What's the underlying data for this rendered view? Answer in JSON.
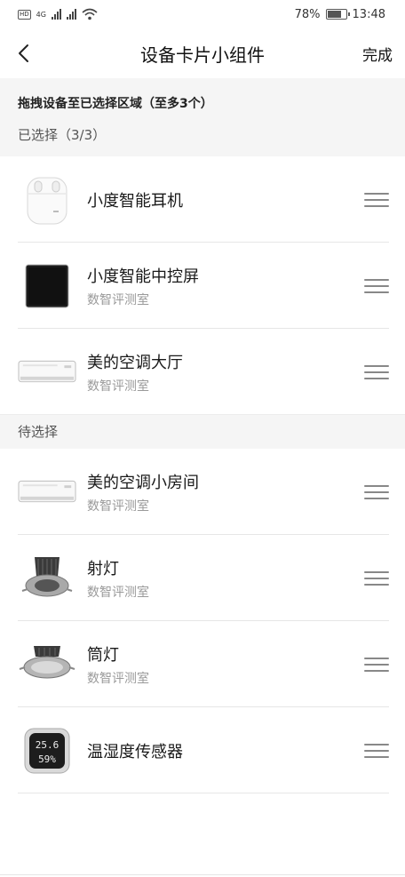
{
  "status": {
    "hd_label": "HD",
    "net_label": "4G",
    "battery": "78%",
    "time": "13:48"
  },
  "header": {
    "title": "设备卡片小组件",
    "done_label": "完成"
  },
  "hint": "拖拽设备至已选择区域（至多3个）",
  "selected": {
    "label": "已选择（3/3）",
    "items": [
      {
        "name": "小度智能耳机",
        "room": "",
        "icon": "earbuds-icon"
      },
      {
        "name": "小度智能中控屏",
        "room": "数智评测室",
        "icon": "smart-screen-icon"
      },
      {
        "name": "美的空调大厅",
        "room": "数智评测室",
        "icon": "air-conditioner-icon"
      }
    ]
  },
  "pending": {
    "label": "待选择",
    "items": [
      {
        "name": "美的空调小房间",
        "room": "数智评测室",
        "icon": "air-conditioner-icon"
      },
      {
        "name": "射灯",
        "room": "数智评测室",
        "icon": "spotlight-icon"
      },
      {
        "name": "筒灯",
        "room": "数智评测室",
        "icon": "downlight-icon"
      },
      {
        "name": "温湿度传感器",
        "room": "",
        "icon": "thermo-hygrometer-icon",
        "display_temp": "25.6",
        "display_humidity": "59%"
      }
    ]
  }
}
